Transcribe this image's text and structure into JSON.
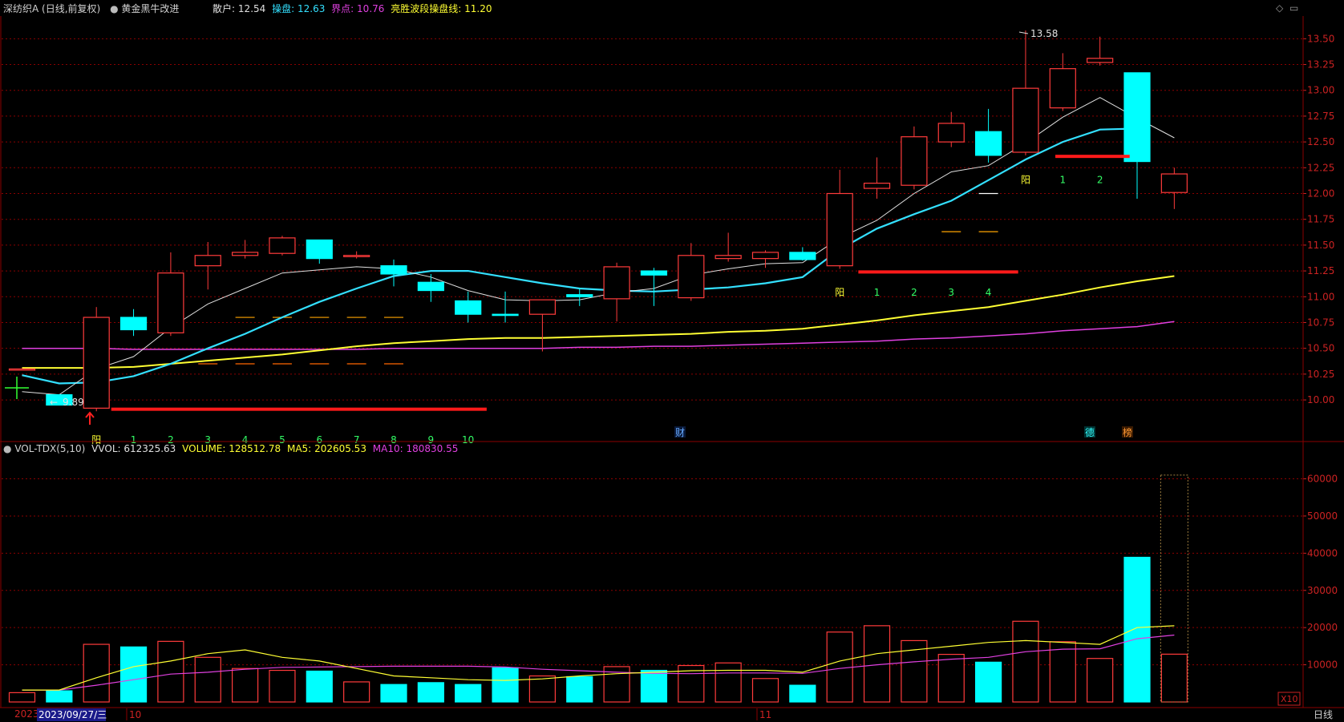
{
  "header": {
    "stock": "深纺织A",
    "period": "(日线,前复权)",
    "indicator": "黄金黑牛改进",
    "retail_label": "散户:",
    "retail_value": "12.54",
    "ctrl_label": "操盘:",
    "ctrl_value": "12.63",
    "bound_label": "界点:",
    "bound_value": "10.76",
    "wave_label": "亮胜波段操盘线:",
    "wave_value": "11.20"
  },
  "volume_header": {
    "name": "VOL-TDX(5,10)",
    "vvol_label": "VVOL:",
    "vvol_value": "612325.63",
    "volume_label": "VOLUME:",
    "volume_value": "128512.78",
    "ma5_label": "MA5:",
    "ma5_value": "202605.53",
    "ma10_label": "MA10:",
    "ma10_value": "180830.55"
  },
  "footer": {
    "year_label": "2023",
    "cursor_date": "2023/09/27/三",
    "month_10": "10",
    "month_11": "11",
    "period_button": "日线",
    "scale_label": "X10"
  },
  "annotations": {
    "high_label": "13.58",
    "low_label": "9.89",
    "cai_marker": "财",
    "de_marker": "德",
    "bang_marker": "榜"
  },
  "colors": {
    "up": "#ff3b3b",
    "down": "#00ffff",
    "ma_white": "#e0e0e0",
    "ma_cyan": "#33e0ff",
    "ma_yellow": "#ffff33",
    "ma_magenta": "#e040e0",
    "signal_bar": "#ff1a1a",
    "count_green": "#33ff66",
    "count_yellow": "#ffff33",
    "grid": "#8b0000",
    "axis_text": "#cc2222"
  },
  "chart_data": {
    "type": "candlestick",
    "price_axis": {
      "ticks": [
        "13.50",
        "13.25",
        "13.00",
        "12.75",
        "12.50",
        "12.25",
        "12.00",
        "11.75",
        "11.50",
        "11.25",
        "11.00",
        "10.75",
        "10.50",
        "10.25",
        "10.00"
      ],
      "range": [
        9.62,
        13.72
      ]
    },
    "volume_axis": {
      "ticks": [
        "60000",
        "50000",
        "40000",
        "30000",
        "20000",
        "10000"
      ],
      "range": [
        0,
        65500
      ]
    },
    "candles": [
      {
        "o": 10.3,
        "h": 10.3,
        "l": 10.3,
        "c": 10.3,
        "up": true,
        "v": 2500
      },
      {
        "o": 10.05,
        "h": 10.05,
        "l": 9.95,
        "c": 9.95,
        "up": false,
        "v": 3000
      },
      {
        "o": 9.92,
        "h": 10.9,
        "l": 9.89,
        "c": 10.8,
        "up": true,
        "v": 15500
      },
      {
        "o": 10.8,
        "h": 10.88,
        "l": 10.62,
        "c": 10.68,
        "up": false,
        "v": 14800
      },
      {
        "o": 10.65,
        "h": 11.43,
        "l": 10.62,
        "c": 11.23,
        "up": true,
        "v": 16300
      },
      {
        "o": 11.3,
        "h": 11.53,
        "l": 11.07,
        "c": 11.4,
        "up": true,
        "v": 12000
      },
      {
        "o": 11.4,
        "h": 11.55,
        "l": 11.37,
        "c": 11.43,
        "up": true,
        "v": 9000
      },
      {
        "o": 11.42,
        "h": 11.59,
        "l": 11.4,
        "c": 11.57,
        "up": true,
        "v": 8500
      },
      {
        "o": 11.55,
        "h": 11.55,
        "l": 11.32,
        "c": 11.37,
        "up": false,
        "v": 8300
      },
      {
        "o": 11.4,
        "h": 11.44,
        "l": 11.37,
        "c": 11.39,
        "up": true,
        "v": 5400
      },
      {
        "o": 11.3,
        "h": 11.36,
        "l": 11.1,
        "c": 11.22,
        "up": false,
        "v": 4700
      },
      {
        "o": 11.14,
        "h": 11.22,
        "l": 10.95,
        "c": 11.06,
        "up": false,
        "v": 5200
      },
      {
        "o": 10.96,
        "h": 11.05,
        "l": 10.75,
        "c": 10.83,
        "up": false,
        "v": 4700
      },
      {
        "o": 10.83,
        "h": 11.05,
        "l": 10.75,
        "c": 10.82,
        "up": false,
        "v": 9200
      },
      {
        "o": 10.83,
        "h": 10.96,
        "l": 10.47,
        "c": 10.97,
        "up": true,
        "v": 7000
      },
      {
        "o": 11.02,
        "h": 11.08,
        "l": 10.91,
        "c": 11.0,
        "up": false,
        "v": 6800
      },
      {
        "o": 10.98,
        "h": 11.33,
        "l": 10.76,
        "c": 11.29,
        "up": true,
        "v": 9500
      },
      {
        "o": 11.25,
        "h": 11.28,
        "l": 10.91,
        "c": 11.21,
        "up": false,
        "v": 8500
      },
      {
        "o": 10.99,
        "h": 11.52,
        "l": 10.96,
        "c": 11.4,
        "up": true,
        "v": 9800
      },
      {
        "o": 11.37,
        "h": 11.62,
        "l": 11.34,
        "c": 11.4,
        "up": true,
        "v": 10500
      },
      {
        "o": 11.37,
        "h": 11.45,
        "l": 11.28,
        "c": 11.43,
        "up": true,
        "v": 6300
      },
      {
        "o": 11.43,
        "h": 11.48,
        "l": 11.35,
        "c": 11.36,
        "up": false,
        "v": 4500
      },
      {
        "o": 11.3,
        "h": 12.23,
        "l": 11.27,
        "c": 12.0,
        "up": true,
        "v": 18800
      },
      {
        "o": 12.05,
        "h": 12.35,
        "l": 11.95,
        "c": 12.1,
        "up": true,
        "v": 20500
      },
      {
        "o": 12.08,
        "h": 12.65,
        "l": 12.04,
        "c": 12.55,
        "up": true,
        "v": 16500
      },
      {
        "o": 12.5,
        "h": 12.79,
        "l": 12.45,
        "c": 12.68,
        "up": true,
        "v": 12800
      },
      {
        "o": 12.6,
        "h": 12.82,
        "l": 12.3,
        "c": 12.37,
        "up": false,
        "v": 10700
      },
      {
        "o": 12.4,
        "h": 13.58,
        "l": 12.37,
        "c": 13.02,
        "up": true,
        "v": 21700
      },
      {
        "o": 12.83,
        "h": 13.36,
        "l": 12.8,
        "c": 13.21,
        "up": true,
        "v": 16200
      },
      {
        "o": 13.27,
        "h": 13.52,
        "l": 13.24,
        "c": 13.31,
        "up": true,
        "v": 11700
      },
      {
        "o": 13.17,
        "h": 13.17,
        "l": 11.95,
        "c": 12.31,
        "up": false,
        "v": 38900
      },
      {
        "o": 12.01,
        "h": 12.25,
        "l": 11.85,
        "c": 12.19,
        "up": true,
        "v": 12850
      }
    ],
    "ma_white": [
      10.08,
      10.05,
      10.3,
      10.42,
      10.7,
      10.93,
      11.08,
      11.23,
      11.26,
      11.29,
      11.27,
      11.19,
      11.06,
      10.97,
      10.96,
      10.97,
      11.04,
      11.08,
      11.21,
      11.27,
      11.32,
      11.33,
      11.57,
      11.74,
      12.0,
      12.21,
      12.27,
      12.49,
      12.74,
      12.93,
      12.73,
      12.54
    ],
    "ma_cyan": [
      10.24,
      10.16,
      10.17,
      10.23,
      10.35,
      10.5,
      10.64,
      10.8,
      10.95,
      11.08,
      11.2,
      11.25,
      11.25,
      11.19,
      11.13,
      11.08,
      11.06,
      11.05,
      11.07,
      11.09,
      11.13,
      11.19,
      11.46,
      11.66,
      11.8,
      11.93,
      12.13,
      12.33,
      12.5,
      12.62,
      12.63,
      null
    ],
    "ma_yellow": [
      10.31,
      10.31,
      10.31,
      10.32,
      10.35,
      10.38,
      10.41,
      10.44,
      10.48,
      10.52,
      10.55,
      10.57,
      10.59,
      10.6,
      10.6,
      10.61,
      10.62,
      10.63,
      10.64,
      10.66,
      10.67,
      10.69,
      10.73,
      10.77,
      10.82,
      10.86,
      10.9,
      10.96,
      11.02,
      11.09,
      11.15,
      11.2
    ],
    "ma_magenta": [
      10.5,
      10.5,
      10.5,
      10.49,
      10.49,
      10.49,
      10.49,
      10.49,
      10.49,
      10.49,
      10.5,
      10.5,
      10.5,
      10.5,
      10.5,
      10.51,
      10.51,
      10.52,
      10.52,
      10.53,
      10.54,
      10.55,
      10.56,
      10.57,
      10.59,
      10.6,
      10.62,
      10.64,
      10.67,
      10.69,
      10.71,
      10.76
    ],
    "vol_ma5": [
      3200,
      3200,
      6500,
      9500,
      11000,
      13000,
      14000,
      12000,
      11000,
      9000,
      7000,
      6500,
      6000,
      5800,
      6200,
      7000,
      7600,
      8000,
      8400,
      8500,
      8500,
      8000,
      11000,
      13000,
      14000,
      15000,
      16000,
      16500,
      16000,
      15500,
      20000,
      20500
    ],
    "vol_ma10": [
      3200,
      3200,
      4500,
      6000,
      7500,
      8000,
      8800,
      9300,
      9400,
      9500,
      9600,
      9600,
      9600,
      9400,
      8800,
      8400,
      8000,
      7700,
      7600,
      7800,
      7800,
      7700,
      9000,
      10000,
      10800,
      11500,
      12000,
      13500,
      14200,
      14300,
      17000,
      18000
    ],
    "cursor_volume_box": 61000,
    "signal_bars": [
      {
        "from": 2.4,
        "to": 12.5,
        "price": 9.91
      },
      {
        "from": 22.5,
        "to": 26.8,
        "price": 11.24
      },
      {
        "from": 27.8,
        "to": 29.8,
        "price": 12.36
      }
    ],
    "dash_levels": [
      {
        "from": 5.6,
        "to": 10.5,
        "price": 10.8,
        "color": "#ffa500"
      },
      {
        "from": 4.8,
        "to": 10.5,
        "price": 10.35,
        "color": "#ff6600"
      },
      {
        "from": 24.5,
        "to": 26.7,
        "price": 11.63,
        "color": "#ffa500"
      },
      {
        "from": 25.5,
        "to": 26.6,
        "price": 12.0,
        "color": "#ffffff"
      }
    ],
    "counts": [
      {
        "labels": [
          "阳",
          "1",
          "2",
          "3",
          "4",
          "5",
          "6",
          "7",
          "8",
          "9",
          "10"
        ],
        "start": 2,
        "price": 9.62
      },
      {
        "labels": [
          "阳",
          "1",
          "2",
          "3",
          "4"
        ],
        "start": 22,
        "price": 11.05
      },
      {
        "labels": [
          "阳",
          "1",
          "2"
        ],
        "start": 27,
        "price": 12.14
      }
    ]
  }
}
